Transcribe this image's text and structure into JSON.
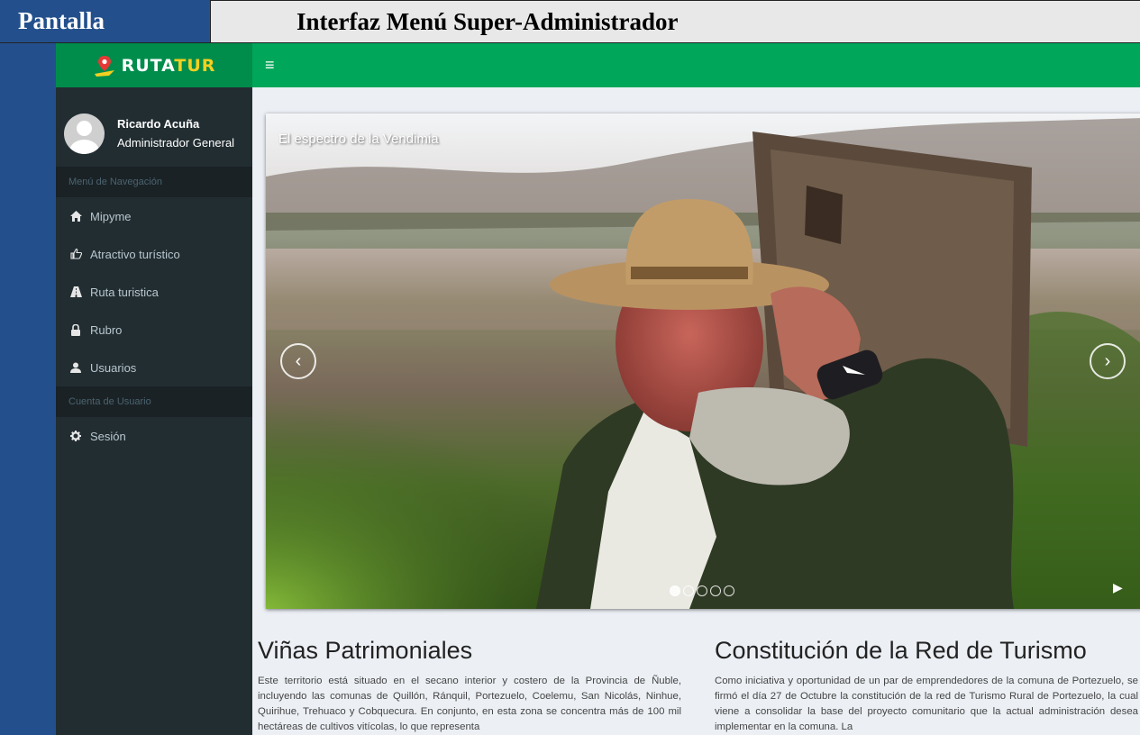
{
  "document": {
    "label": "Pantalla",
    "title": "Interfaz Menú Super-Administrador"
  },
  "app": {
    "logo_part1": "RUTA",
    "logo_part2": "TUR",
    "colors": {
      "header": "#00a65a",
      "logo_bg": "#008d4c",
      "sidebar": "#222d32",
      "section": "#1a2226"
    }
  },
  "user": {
    "name": "Ricardo Acuña",
    "role": "Administrador General"
  },
  "sidebar": {
    "nav_header": "Menú de Navegación",
    "items": [
      {
        "label": "Mipyme",
        "icon": "home-icon"
      },
      {
        "label": "Atractivo turístico",
        "icon": "thumbs-up-icon"
      },
      {
        "label": "Ruta turistica",
        "icon": "road-icon"
      },
      {
        "label": "Rubro",
        "icon": "lock-icon"
      },
      {
        "label": "Usuarios",
        "icon": "user-icon"
      }
    ],
    "account_header": "Cuenta de Usuario",
    "account_items": [
      {
        "label": "Sesión",
        "icon": "gear-icon"
      }
    ]
  },
  "carousel": {
    "caption": "El espectro de la Vendimia",
    "slide_count": 5,
    "active_index": 0
  },
  "articles": [
    {
      "title": "Viñas Patrimoniales",
      "body": "Este territorio está situado en el secano interior y costero de la Provincia de Ñuble, incluyendo las comunas de Quillón, Ránquil, Portezuelo, Coelemu, San Nicolás, Ninhue, Quirihue, Trehuaco y Cobquecura. En conjunto, en esta zona se concentra más de 100 mil hectáreas de cultivos vitícolas, lo que representa"
    },
    {
      "title": "Constitución de la Red de Turismo",
      "body": "Como iniciativa y oportunidad de un par de emprendedores de la comuna de Portezuelo, se firmó el día 27 de Octubre la constitución de la red de Turismo Rural de Portezuelo, la cual viene a consolidar la base del proyecto comunitario que la actual administración desea implementar en la comuna. La"
    }
  ]
}
